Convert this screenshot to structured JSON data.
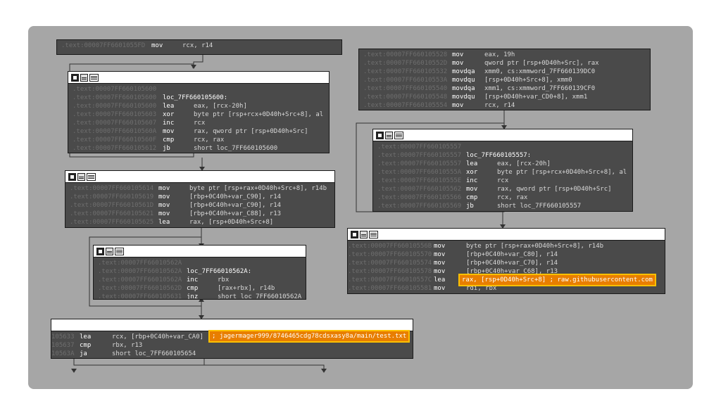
{
  "nodes": {
    "top_left_partial": {
      "lines": [
        {
          "addr": ".text:00007FF6601055FD",
          "mn": "mov",
          "op": "rcx, r14"
        }
      ]
    },
    "top_right": {
      "lines": [
        {
          "addr": ".text:00007FF660105528",
          "mn": "mov",
          "op": "eax, 19h"
        },
        {
          "addr": ".text:00007FF66010552D",
          "mn": "mov",
          "op": "qword ptr [rsp+0D40h+Src], rax"
        },
        {
          "addr": ".text:00007FF660105532",
          "mn": "movdqa",
          "op": "xmm0, cs:xmmword_7FF660139DC0"
        },
        {
          "addr": ".text:00007FF66010553A",
          "mn": "movdqu",
          "op": "[rsp+0D40h+Src+8], xmm0"
        },
        {
          "addr": ".text:00007FF660105540",
          "mn": "movdqa",
          "op": "xmm1, cs:xmmword_7FF660139CF0"
        },
        {
          "addr": ".text:00007FF660105548",
          "mn": "movdqu",
          "op": "[rsp+0D40h+var_CD0+8], xmm1"
        },
        {
          "addr": ".text:00007FF660105554",
          "mn": "mov",
          "op": "rcx, r14"
        }
      ]
    },
    "loop_600": {
      "lines": [
        {
          "addr": ".text:00007FF660105600",
          "mn": "",
          "op": ""
        },
        {
          "addr": ".text:00007FF660105600",
          "label": "loc_7FF660105600:"
        },
        {
          "addr": ".text:00007FF660105600",
          "mn": "lea",
          "op": "eax, [rcx-20h]"
        },
        {
          "addr": ".text:00007FF660105603",
          "mn": "xor",
          "op": "byte ptr [rsp+rcx+0D40h+Src+8], al"
        },
        {
          "addr": ".text:00007FF660105607",
          "mn": "inc",
          "op": "rcx"
        },
        {
          "addr": ".text:00007FF66010560A",
          "mn": "mov",
          "op": "rax, qword ptr [rsp+0D40h+Src]"
        },
        {
          "addr": ".text:00007FF66010560F",
          "mn": "cmp",
          "op": "rcx, rax"
        },
        {
          "addr": ".text:00007FF660105612",
          "mn": "jb",
          "op": "short loc_7FF660105600"
        }
      ]
    },
    "loop_557": {
      "lines": [
        {
          "addr": ".text:00007FF660105557",
          "mn": "",
          "op": ""
        },
        {
          "addr": ".text:00007FF660105557",
          "label": "loc_7FF660105557:"
        },
        {
          "addr": ".text:00007FF660105557",
          "mn": "lea",
          "op": "eax, [rcx-20h]"
        },
        {
          "addr": ".text:00007FF66010555A",
          "mn": "xor",
          "op": "byte ptr [rsp+rcx+0D40h+Src+8], al"
        },
        {
          "addr": ".text:00007FF66010555E",
          "mn": "inc",
          "op": "rcx"
        },
        {
          "addr": ".text:00007FF660105562",
          "mn": "mov",
          "op": "rax, qword ptr [rsp+0D40h+Src]"
        },
        {
          "addr": ".text:00007FF660105566",
          "mn": "cmp",
          "op": "rcx, rax"
        },
        {
          "addr": ".text:00007FF660105569",
          "mn": "jb",
          "op": "short loc_7FF660105557"
        }
      ]
    },
    "block_614": {
      "lines": [
        {
          "addr": ".text:00007FF660105614",
          "mn": "mov",
          "op": "byte ptr [rsp+rax+0D40h+Src+8], r14b"
        },
        {
          "addr": ".text:00007FF660105619",
          "mn": "mov",
          "op": "[rbp+0C40h+var_C90], r14"
        },
        {
          "addr": ".text:00007FF66010561D",
          "mn": "mov",
          "op": "[rbp+0C40h+var_C90], r14"
        },
        {
          "addr": ".text:00007FF660105621",
          "mn": "mov",
          "op": "[rbp+0C40h+var_C88], r13"
        },
        {
          "addr": ".text:00007FF660105625",
          "mn": "lea",
          "op": "rax, [rsp+0D40h+Src+8]"
        }
      ]
    },
    "block_56B": {
      "lines": [
        {
          "addr": ".text:00007FF66010556B",
          "mn": "mov",
          "op": "byte ptr [rsp+rax+0D40h+Src+8], r14b"
        },
        {
          "addr": ".text:00007FF660105570",
          "mn": "mov",
          "op": "[rbp+0C40h+var_C80], r14"
        },
        {
          "addr": ".text:00007FF660105574",
          "mn": "mov",
          "op": "[rbp+0C40h+var_C70], r14"
        },
        {
          "addr": ".text:00007FF660105578",
          "mn": "mov",
          "op": "[rbp+0C40h+var_C68], r13"
        },
        {
          "addr": ".text:00007FF66010557C",
          "mn": "lea",
          "op": "rax, [rsp+0D40h+Src+8]"
        },
        {
          "addr": ".text:00007FF660105581",
          "mn": "mov",
          "op": "rdi, rbx"
        }
      ],
      "string_comment": "; raw.githubusercontent.com"
    },
    "loop_62A": {
      "lines": [
        {
          "addr": ".text:00007FF66010562A",
          "mn": "",
          "op": ""
        },
        {
          "addr": ".text:00007FF66010562A",
          "label": "loc_7FF66010562A:"
        },
        {
          "addr": ".text:00007FF66010562A",
          "mn": "inc",
          "op": "rbx"
        },
        {
          "addr": ".text:00007FF66010562D",
          "mn": "cmp",
          "op": "[rax+rbx], r14b"
        },
        {
          "addr": ".text:00007FF660105631",
          "mn": "jnz",
          "op": "short loc_7FF66010562A"
        }
      ]
    },
    "block_633": {
      "lines": [
        {
          "addr": "105633",
          "mn": "lea",
          "op": "rcx, [rbp+0C40h+var_CA0]"
        },
        {
          "addr": "105637",
          "mn": "cmp",
          "op": "rbx, r13"
        },
        {
          "addr": "10563A",
          "mn": "ja",
          "op": "short loc_7FF660105654"
        }
      ],
      "string_comment": "; jagermager999/8746465cdg78cdsxasy8a/main/test.txt"
    }
  },
  "colors": {
    "canvas_bg": "#a6a6a6",
    "node_bg": "#4a4a4a",
    "highlight_fill": "#e87e00",
    "highlight_border": "#ffc000"
  }
}
